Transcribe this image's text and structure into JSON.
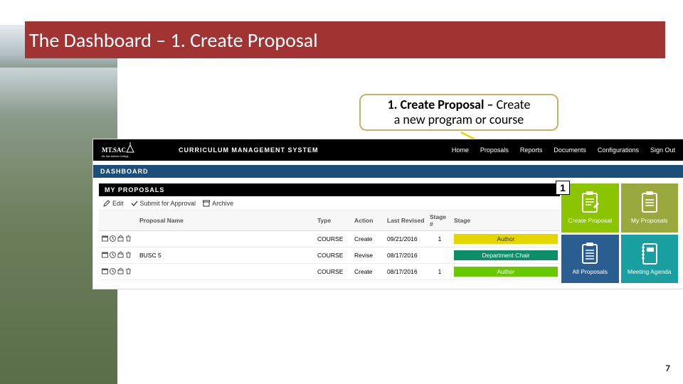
{
  "slide": {
    "title": "The Dashboard – 1. Create Proposal",
    "page_number": "7"
  },
  "callout": {
    "bold": "1. Create Proposal – ",
    "rest_line1": "Create",
    "line2": "a new program or course"
  },
  "badge": {
    "number": "1"
  },
  "screenshot": {
    "college_name": "Mt. San Antonio College",
    "system_title": "CURRICULUM MANAGEMENT SYSTEM",
    "nav": {
      "home": "Home",
      "proposals": "Proposals",
      "reports": "Reports",
      "documents": "Documents",
      "configurations": "Configurations",
      "sign_out": "Sign Out"
    },
    "dashboard_label": "DASHBOARD",
    "panel_title": "MY PROPOSALS",
    "toolbar": {
      "edit": "Edit",
      "submit": "Submit for Approval",
      "archive": "Archive"
    },
    "columns": {
      "proposal_name": "Proposal Name",
      "type": "Type",
      "action": "Action",
      "last_revised": "Last Revised",
      "stage_num": "Stage #",
      "stage": "Stage"
    },
    "rows": [
      {
        "name": "",
        "type": "COURSE",
        "action": "Create",
        "date": "09/21/2016",
        "stage_n": "1",
        "stage": "Author",
        "stage_class": "stage-yellow"
      },
      {
        "name": "BUSC 5",
        "type": "COURSE",
        "action": "Revise",
        "date": "08/17/2016",
        "stage_n": "",
        "stage": "Department Chair",
        "stage_class": "stage-teal"
      },
      {
        "name": "",
        "type": "COURSE",
        "action": "Create",
        "date": "08/17/2016",
        "stage_n": "1",
        "stage": "Author",
        "stage_class": "stage-green"
      }
    ],
    "tiles": {
      "create_proposal": "Create Proposal",
      "my_proposals": "My Proposals",
      "all_proposals": "All Proposals",
      "meeting_agenda": "Meeting Agenda"
    }
  }
}
